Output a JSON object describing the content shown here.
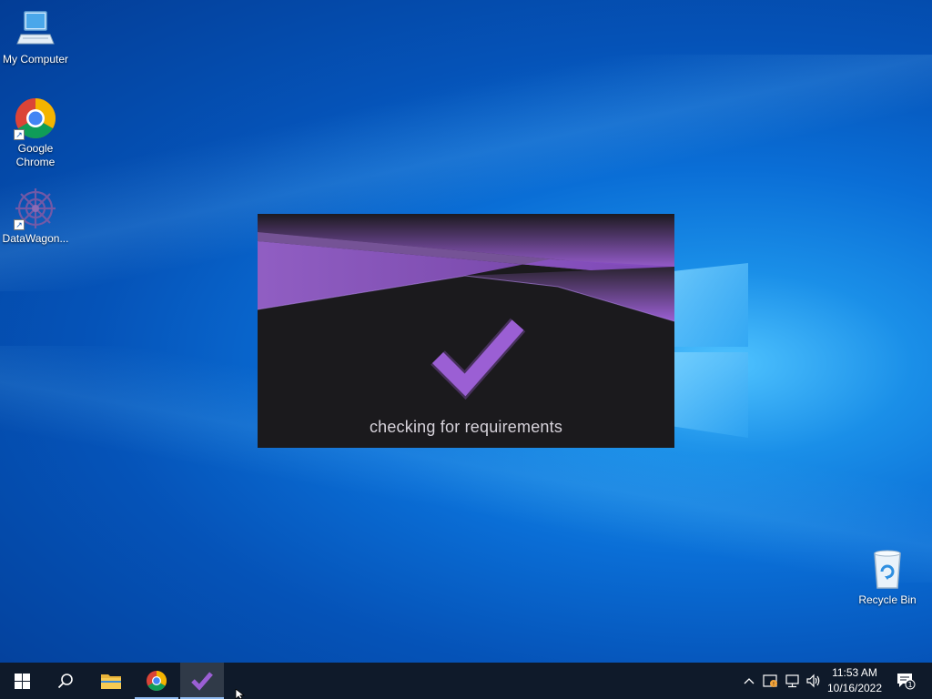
{
  "desktop": {
    "icons": [
      {
        "label": "My Computer",
        "icon": "computer-icon"
      },
      {
        "label": "Google Chrome",
        "icon": "chrome-icon"
      },
      {
        "label": "DataWagon...",
        "icon": "datawagon-icon"
      },
      {
        "label": "Recycle Bin",
        "icon": "recycle-bin-icon"
      }
    ]
  },
  "splash": {
    "status_text": "checking for requirements",
    "accent_color": "#9b5fd4",
    "background_color": "#1b1a1d"
  },
  "taskbar": {
    "apps": [
      "start-icon",
      "search-icon",
      "file-explorer-icon",
      "chrome-icon",
      "datawagon-checkmark-icon"
    ],
    "active_app": "datawagon-checkmark-icon",
    "tray_icons": [
      "chevron-up-icon",
      "security-icon",
      "network-icon",
      "volume-icon"
    ],
    "time": "11:53 AM",
    "date": "10/16/2022",
    "notification_count": "1"
  }
}
